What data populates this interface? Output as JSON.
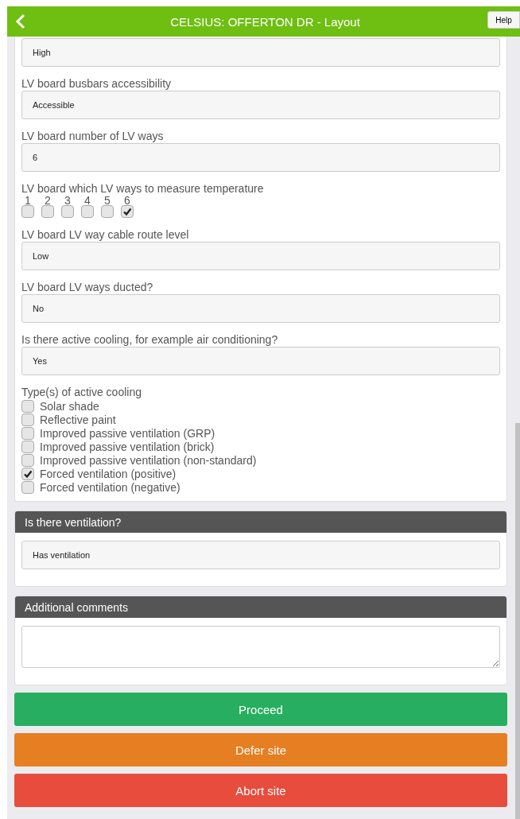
{
  "header": {
    "title": "CELSIUS: OFFERTON DR - Layout",
    "help": "Help"
  },
  "form": [
    {
      "kind": "field",
      "value": "High"
    },
    {
      "kind": "field",
      "label": "LV board busbars accessibility",
      "value": "Accessible"
    },
    {
      "kind": "field",
      "label": "LV board number of LV ways",
      "value": "6"
    },
    {
      "kind": "grid",
      "label": "LV board which LV ways to measure temperature",
      "options": [
        {
          "label": "1",
          "checked": false
        },
        {
          "label": "2",
          "checked": false
        },
        {
          "label": "3",
          "checked": false
        },
        {
          "label": "4",
          "checked": false
        },
        {
          "label": "5",
          "checked": false
        },
        {
          "label": "6",
          "checked": true
        }
      ]
    },
    {
      "kind": "field",
      "label": "LV board LV way cable route level",
      "value": "Low"
    },
    {
      "kind": "field",
      "label": "LV board LV ways ducted?",
      "value": "No"
    },
    {
      "kind": "field",
      "label": "Is there active cooling, for example air conditioning?",
      "value": "Yes"
    },
    {
      "kind": "list",
      "label": "Type(s) of active cooling",
      "options": [
        {
          "label": "Solar shade",
          "checked": false
        },
        {
          "label": "Reflective paint",
          "checked": false
        },
        {
          "label": "Improved passive ventilation (GRP)",
          "checked": false
        },
        {
          "label": "Improved passive ventilation (brick)",
          "checked": false
        },
        {
          "label": "Improved passive ventilation (non-standard)",
          "checked": false
        },
        {
          "label": "Forced ventilation (positive)",
          "checked": true
        },
        {
          "label": "Forced ventilation (negative)",
          "checked": false
        }
      ]
    }
  ],
  "sections": [
    {
      "title": "Is there ventilation?",
      "kind": "field",
      "value": "Has ventilation"
    },
    {
      "title": "Additional comments",
      "kind": "textarea"
    }
  ],
  "buttons": [
    {
      "label": "Proceed",
      "color": "#27ae60"
    },
    {
      "label": "Defer site",
      "color": "#e67e22"
    },
    {
      "label": "Abort site",
      "color": "#e74c3c"
    }
  ]
}
